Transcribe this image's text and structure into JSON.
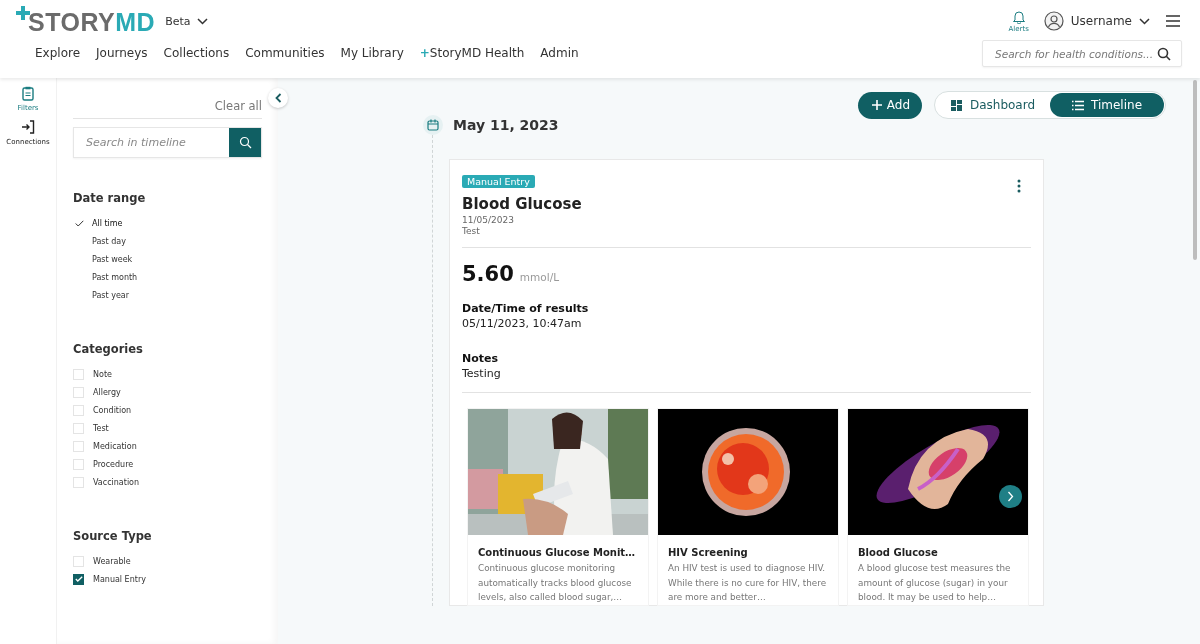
{
  "header": {
    "logo": {
      "part_1": "STORY",
      "part_2": "MD"
    },
    "edition": "Beta",
    "nav": [
      {
        "label": "Explore"
      },
      {
        "label": "Journeys"
      },
      {
        "label": "Collections"
      },
      {
        "label": "Communities"
      },
      {
        "label": "My Library"
      },
      {
        "label": "StoryMD Health",
        "prefix": "+"
      },
      {
        "label": "Admin"
      }
    ],
    "alerts": {
      "label": "Alerts"
    },
    "user": {
      "name": "Username"
    },
    "search": {
      "placeholder": "Search for health conditions..."
    }
  },
  "rail": [
    {
      "label": "Filters",
      "selected": true
    },
    {
      "label": "Connections",
      "selected": false
    }
  ],
  "filters": {
    "clear": "Clear all",
    "search": {
      "placeholder": "Search in timeline"
    },
    "date_range": {
      "title": "Date range",
      "options": [
        {
          "label": "All time",
          "selected": true
        },
        {
          "label": "Past day",
          "selected": false
        },
        {
          "label": "Past week",
          "selected": false
        },
        {
          "label": "Past month",
          "selected": false
        },
        {
          "label": "Past year",
          "selected": false
        }
      ]
    },
    "categories": {
      "title": "Categories",
      "options": [
        {
          "label": "Note",
          "checked": false
        },
        {
          "label": "Allergy",
          "checked": false
        },
        {
          "label": "Condition",
          "checked": false
        },
        {
          "label": "Test",
          "checked": false
        },
        {
          "label": "Medication",
          "checked": false
        },
        {
          "label": "Procedure",
          "checked": false
        },
        {
          "label": "Vaccination",
          "checked": false
        }
      ]
    },
    "source_type": {
      "title": "Source Type",
      "options": [
        {
          "label": "Wearable",
          "checked": false
        },
        {
          "label": "Manual Entry",
          "checked": true
        }
      ]
    }
  },
  "toolbar": {
    "add": "Add",
    "views": [
      {
        "label": "Dashboard",
        "selected": false
      },
      {
        "label": "Timeline",
        "selected": true
      }
    ]
  },
  "timeline": {
    "date": "May 11, 2023",
    "entry": {
      "tag": "Manual Entry",
      "title": "Blood Glucose",
      "date": "11/05/2023",
      "category": "Test",
      "value": "5.60",
      "unit": "mmol/L",
      "fields": [
        {
          "label": "Date/Time of results",
          "value": "05/11/2023, 10:47am"
        },
        {
          "label": "Notes",
          "value": "Testing"
        }
      ],
      "related": [
        {
          "kind": "picture",
          "title": "Continuous Glucose Monit…",
          "description": "Continuous glucose monitoring automatically tracks blood glucose levels, also called blood sugar,…"
        },
        {
          "kind": "picture",
          "title": "HIV Screening",
          "description": "An HIV test is used to diagnose HIV. While there is no cure for HIV, there are more and better…"
        },
        {
          "kind": "picture",
          "title": "Blood Glucose",
          "description": "A blood glucose test measures the amount of glucose (sugar) in your blood. It may be used to help…"
        }
      ]
    }
  }
}
